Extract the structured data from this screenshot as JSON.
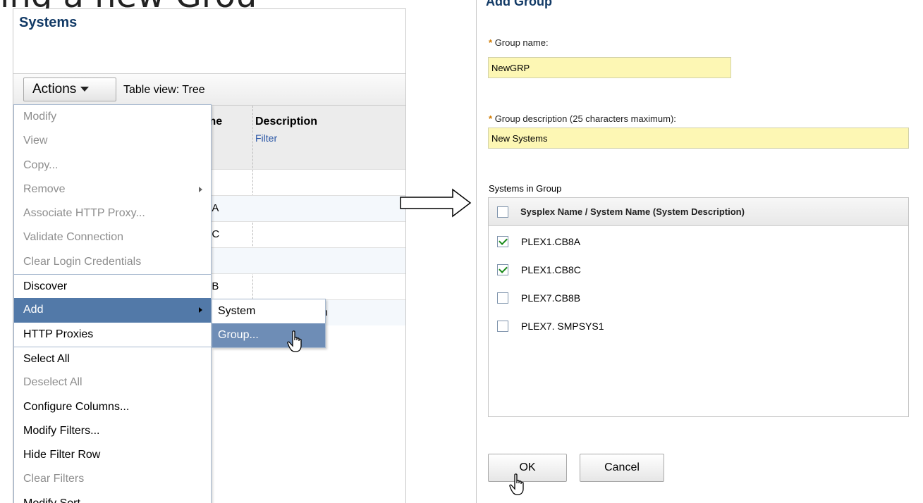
{
  "slide": {
    "title_fragment": "ing a new Grou"
  },
  "left": {
    "title": "Systems",
    "actions_label": "Actions",
    "table_view": "Table view: Tree",
    "columns": {
      "name_partial": "me",
      "description": "Description",
      "filter": "Filter"
    },
    "rows": [
      {
        "name": "",
        "desc": ""
      },
      {
        "name": "3A",
        "desc": ""
      },
      {
        "name": "3C",
        "desc": ""
      },
      {
        "name": "",
        "desc": ""
      },
      {
        "name": "3B",
        "desc": ""
      },
      {
        "name": "",
        "desc": "ded system"
      }
    ],
    "menu": [
      {
        "label": "Modify",
        "disabled": true
      },
      {
        "label": "View",
        "disabled": true
      },
      {
        "label": "Copy...",
        "disabled": true
      },
      {
        "label": "Remove",
        "disabled": true,
        "submenu": true
      },
      {
        "label": "Associate HTTP Proxy...",
        "disabled": true
      },
      {
        "label": "Validate Connection",
        "disabled": true
      },
      {
        "label": "Clear Login Credentials",
        "disabled": true
      },
      {
        "label": "Discover",
        "disabled": false,
        "sep": true
      },
      {
        "label": "Add",
        "disabled": false,
        "selected": true,
        "submenu": true
      },
      {
        "label": "HTTP Proxies",
        "disabled": false
      },
      {
        "label": "Select All",
        "disabled": false,
        "sep": true
      },
      {
        "label": "Deselect All",
        "disabled": true
      },
      {
        "label": "Configure Columns...",
        "disabled": false
      },
      {
        "label": "Modify Filters...",
        "disabled": false
      },
      {
        "label": "Hide Filter Row",
        "disabled": false
      },
      {
        "label": "Clear Filters",
        "disabled": true
      },
      {
        "label": "Modify Sort...",
        "disabled": false
      }
    ],
    "submenu": [
      {
        "label": "System",
        "selected": false
      },
      {
        "label": "Group...",
        "selected": true
      }
    ]
  },
  "right": {
    "title": "Add Group",
    "group_name_label": "Group name:",
    "group_name_value": "NewGRP",
    "group_desc_label": "Group description (25 characters maximum):",
    "group_desc_value": "New Systems",
    "systems_label": "Systems in Group",
    "systems_header": "Sysplex Name / System Name (System Description)",
    "systems": [
      {
        "name": "PLEX1.CB8A",
        "checked": true
      },
      {
        "name": "PLEX1.CB8C",
        "checked": true
      },
      {
        "name": "PLEX7.CB8B",
        "checked": false
      },
      {
        "name": "PLEX7. SMPSYS1",
        "checked": false
      }
    ],
    "ok_label": "OK",
    "cancel_label": "Cancel"
  },
  "colors": {
    "accent": "#5279a8",
    "input_bg": "#fdf7b4",
    "title": "#123a66"
  }
}
